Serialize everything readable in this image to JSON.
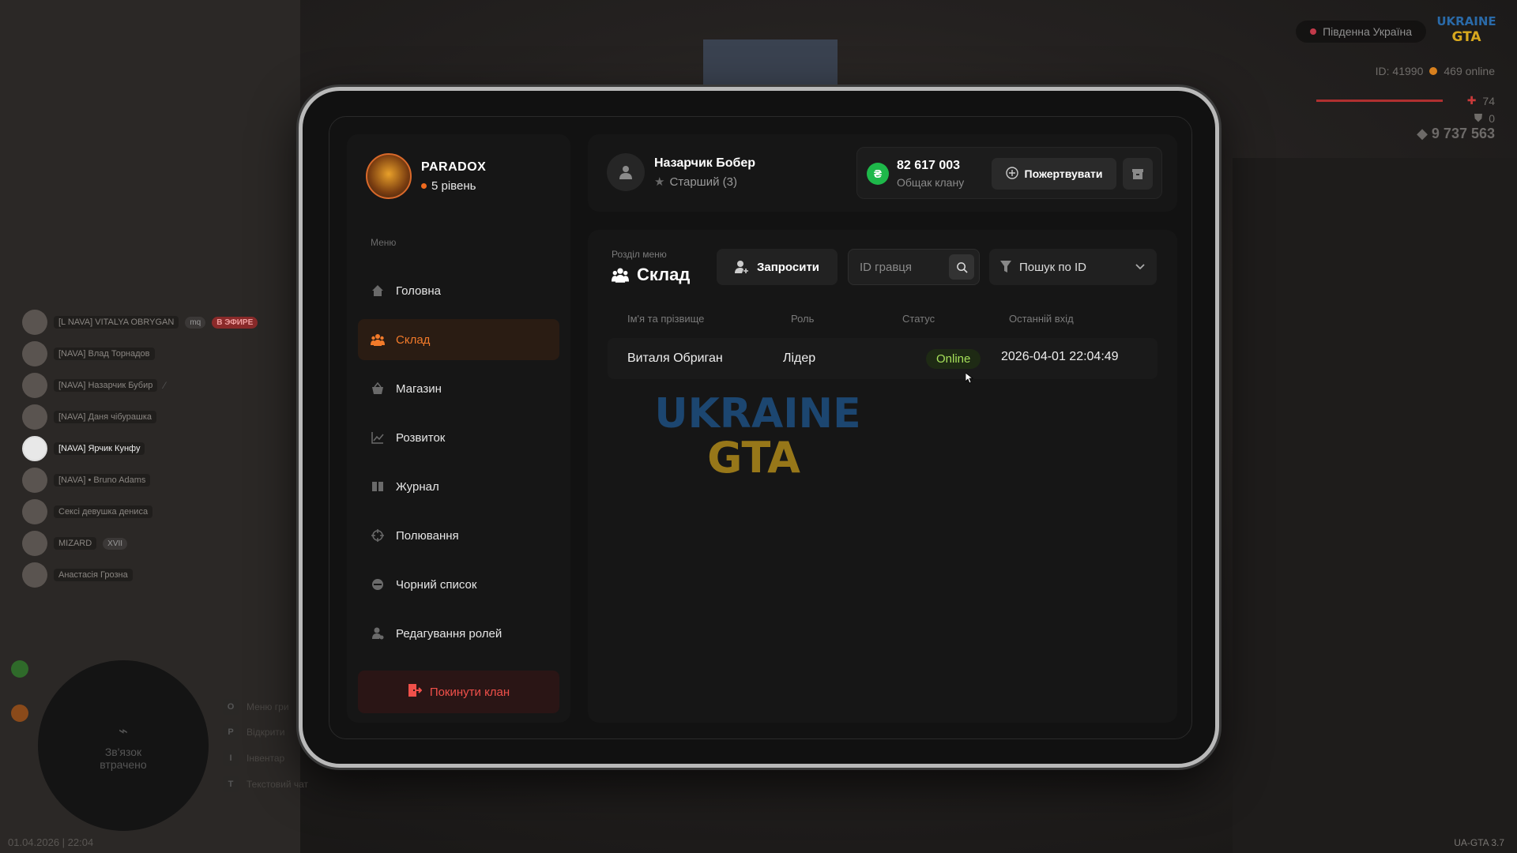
{
  "hud": {
    "region": "Південна Україна",
    "player_id": "ID: 41990",
    "online": "469 online",
    "health": "74",
    "armor": "0",
    "money": "9 737 563",
    "version": "UA-GTA 3.7",
    "datetime": "01.04.2026 | 22:04",
    "minimap_text": "Зв'язок втрачено",
    "keybinds": [
      {
        "key": "O",
        "label": "Меню гри"
      },
      {
        "key": "P",
        "label": "Відкрити"
      },
      {
        "key": "I",
        "label": "Інвентар"
      },
      {
        "key": "T",
        "label": "Текстовий чат"
      }
    ]
  },
  "voice_chat": [
    {
      "name": "[L NAVA] VITALYA OBRYGAN",
      "extra": "mq",
      "tag": "В ЭФИРЕ",
      "selected": false
    },
    {
      "name": "[NAVA] Влад Торнадов",
      "selected": false
    },
    {
      "name": "[NAVA] Назарчик Бубир",
      "selected": false
    },
    {
      "name": "[NAVA] Даня чібурашка",
      "selected": false
    },
    {
      "name": "[NAVA] Ярчик Кунфу",
      "selected": true
    },
    {
      "name": "[NAVA] • Bruno Adams",
      "selected": false
    },
    {
      "name": "Сексі девушка дениса",
      "selected": false
    },
    {
      "name": "MIZARD",
      "extra": "XVII",
      "selected": false
    },
    {
      "name": "Анастасія Грозна",
      "selected": false
    }
  ],
  "clan": {
    "name": "PARADOX",
    "level": "5 рівень"
  },
  "sidebar": {
    "menu_heading": "Меню",
    "items": [
      {
        "label": "Головна",
        "icon": "home-icon",
        "active": false
      },
      {
        "label": "Склад",
        "icon": "members-icon",
        "active": true
      },
      {
        "label": "Магазин",
        "icon": "basket-icon",
        "active": false
      },
      {
        "label": "Розвиток",
        "icon": "chart-icon",
        "active": false
      },
      {
        "label": "Журнал",
        "icon": "book-icon",
        "active": false
      },
      {
        "label": "Полювання",
        "icon": "crosshair-icon",
        "active": false
      },
      {
        "label": "Чорний список",
        "icon": "block-icon",
        "active": false
      },
      {
        "label": "Редагування ролей",
        "icon": "user-role-icon",
        "active": false
      }
    ],
    "leave_label": "Покинути клан"
  },
  "user": {
    "name": "Назарчик Бобер",
    "rank": "Старший (3)"
  },
  "bank": {
    "amount": "82 617 003",
    "label": "Общак клану",
    "currency_symbol": "₴",
    "donate_label": "Пожертвувати"
  },
  "section": {
    "label": "Розділ меню",
    "title": "Склад",
    "invite_label": "Запросити",
    "id_placeholder": "ID гравця",
    "filter_label": "Пошук по ID"
  },
  "table": {
    "headers": [
      "Ім'я та прізвище",
      "Роль",
      "Статус",
      "Останній вхід"
    ],
    "rows": [
      {
        "name": "Виталя Обриган",
        "role": "Лідер",
        "status": "Online",
        "last_login": "2026-04-01 22:04:49"
      }
    ]
  },
  "colors": {
    "accent": "#f27a2a",
    "danger": "#f0504a",
    "online": "#a6e05a",
    "coin": "#1eb84a"
  }
}
